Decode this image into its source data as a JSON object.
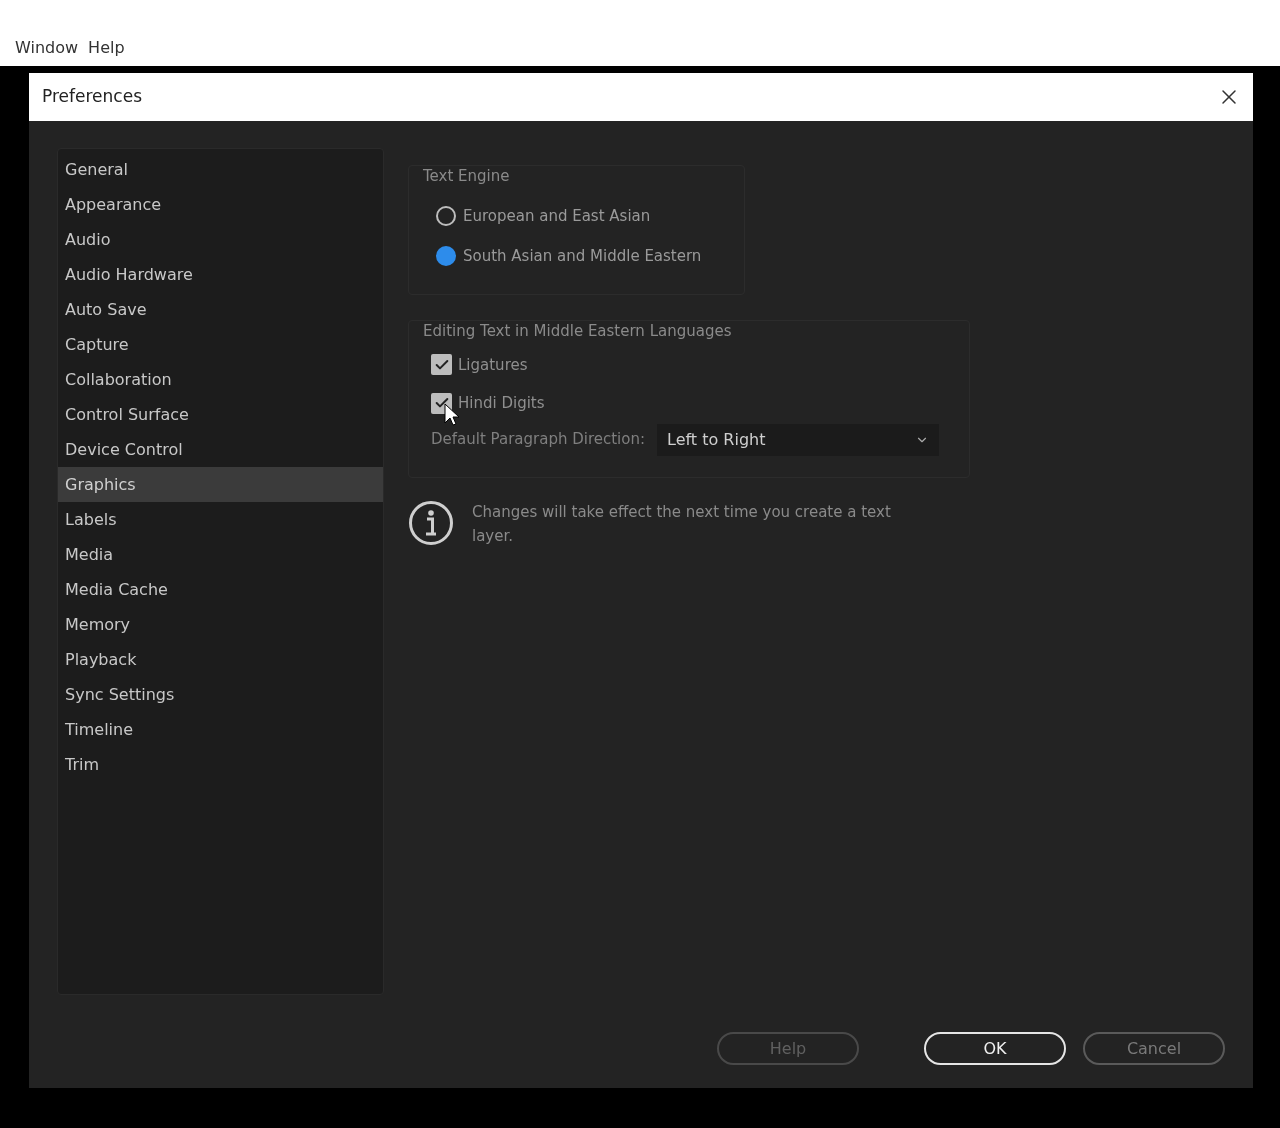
{
  "menu": [
    "Window",
    "Help"
  ],
  "dialog": {
    "title": "Preferences"
  },
  "sidebar": {
    "items": [
      {
        "label": "General",
        "selected": false
      },
      {
        "label": "Appearance",
        "selected": false
      },
      {
        "label": "Audio",
        "selected": false
      },
      {
        "label": "Audio Hardware",
        "selected": false
      },
      {
        "label": "Auto Save",
        "selected": false
      },
      {
        "label": "Capture",
        "selected": false
      },
      {
        "label": "Collaboration",
        "selected": false
      },
      {
        "label": "Control Surface",
        "selected": false
      },
      {
        "label": "Device Control",
        "selected": false
      },
      {
        "label": "Graphics",
        "selected": true
      },
      {
        "label": "Labels",
        "selected": false
      },
      {
        "label": "Media",
        "selected": false
      },
      {
        "label": "Media Cache",
        "selected": false
      },
      {
        "label": "Memory",
        "selected": false
      },
      {
        "label": "Playback",
        "selected": false
      },
      {
        "label": "Sync Settings",
        "selected": false
      },
      {
        "label": "Timeline",
        "selected": false
      },
      {
        "label": "Trim",
        "selected": false
      }
    ]
  },
  "text_engine": {
    "label": "Text Engine",
    "options": [
      {
        "label": "European and East Asian",
        "selected": false
      },
      {
        "label": "South Asian and Middle Eastern",
        "selected": true
      }
    ]
  },
  "editing": {
    "label": "Editing Text in Middle Eastern Languages",
    "checkboxes": [
      {
        "label": "Ligatures",
        "checked": true
      },
      {
        "label": "Hindi Digits",
        "checked": true
      }
    ],
    "direction": {
      "label": "Default Paragraph Direction:",
      "value": "Left to Right"
    }
  },
  "info": "Changes will take effect the next time you create a text layer.",
  "buttons": [
    {
      "label": "Help",
      "kind": "normal",
      "disabled": true
    },
    {
      "label": "OK",
      "kind": "default",
      "disabled": false
    },
    {
      "label": "Cancel",
      "kind": "normal",
      "disabled": false
    }
  ]
}
